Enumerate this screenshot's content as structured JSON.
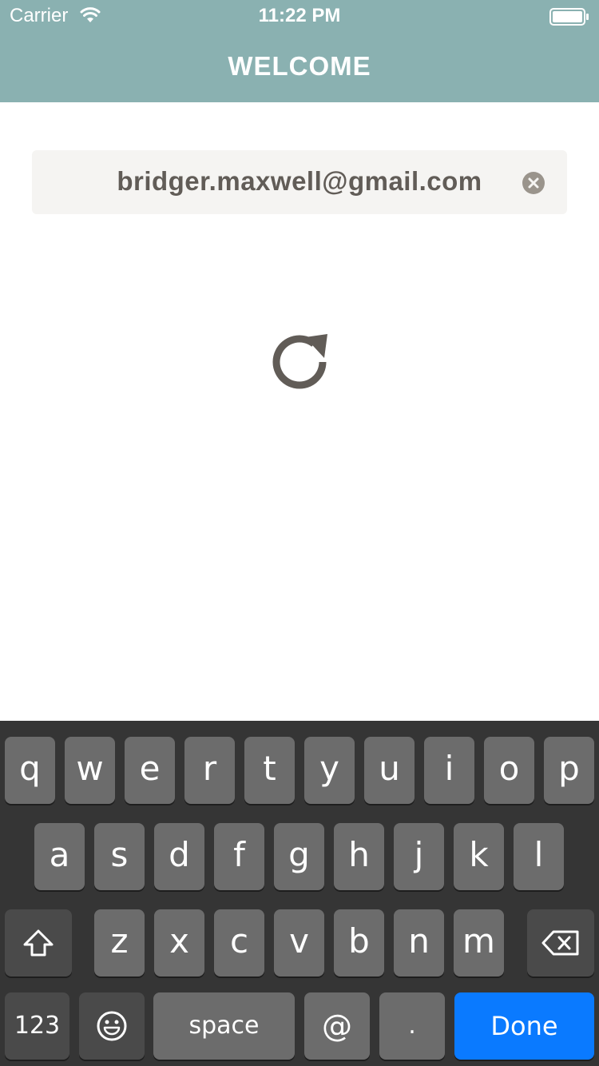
{
  "status_bar": {
    "carrier": "Carrier",
    "time": "11:22 PM"
  },
  "nav": {
    "title": "WELCOME"
  },
  "email_field": {
    "value": "bridger.maxwell@gmail.com"
  },
  "keyboard": {
    "row1": [
      "q",
      "w",
      "e",
      "r",
      "t",
      "y",
      "u",
      "i",
      "o",
      "p"
    ],
    "row2": [
      "a",
      "s",
      "d",
      "f",
      "g",
      "h",
      "j",
      "k",
      "l"
    ],
    "row3": [
      "z",
      "x",
      "c",
      "v",
      "b",
      "n",
      "m"
    ],
    "numbers_label": "123",
    "space_label": "space",
    "at_label": "@",
    "period_label": ".",
    "done_label": "Done"
  },
  "colors": {
    "header": "#8ab1b1",
    "field_bg": "#f5f4f2",
    "text": "#615c57",
    "keyboard_bg": "#353535",
    "key": "#6c6c6c",
    "done": "#0a7aff"
  },
  "icons": [
    "wifi-icon",
    "battery-icon",
    "clear-icon",
    "refresh-icon",
    "shift-icon",
    "backspace-icon",
    "emoji-icon"
  ]
}
